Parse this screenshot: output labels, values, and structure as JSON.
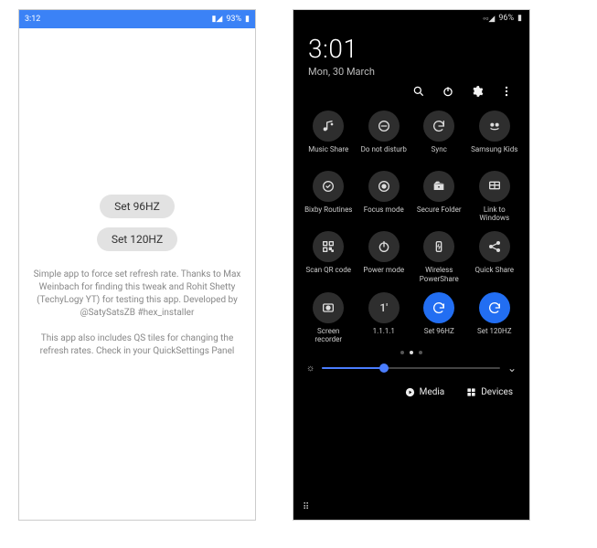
{
  "left": {
    "statusbar": {
      "time": "3:12",
      "battery": "93%"
    },
    "buttons": {
      "set96": "Set 96HZ",
      "set120": "Set 120HZ"
    },
    "desc1": "Simple app to force set refresh rate. Thanks to Max Weinbach for finding this tweak and Rohit Shetty (TechyLogy YT) for testing this app. Developed by @SatySatsZB #hex_installer",
    "desc2": "This app also includes QS tiles for changing the refresh rates. Check in your QuickSettings Panel"
  },
  "right": {
    "statusbar": {
      "battery": "96%"
    },
    "clock": {
      "time": "3:01",
      "date": "Mon, 30 March"
    },
    "actions": {
      "search": "Search",
      "power": "Power",
      "settings": "Settings",
      "more": "More"
    },
    "tiles": [
      {
        "icon": "music-share",
        "label": "Music Share",
        "active": false
      },
      {
        "icon": "dnd",
        "label": "Do not disturb",
        "active": false
      },
      {
        "icon": "sync",
        "label": "Sync",
        "active": false
      },
      {
        "icon": "samsung-kids",
        "label": "Samsung Kids",
        "active": false
      },
      {
        "icon": "bixby",
        "label": "Bixby Routines",
        "active": false
      },
      {
        "icon": "focus",
        "label": "Focus mode",
        "active": false
      },
      {
        "icon": "secure-folder",
        "label": "Secure Folder",
        "active": false
      },
      {
        "icon": "link-windows",
        "label": "Link to Windows",
        "active": false
      },
      {
        "icon": "qr",
        "label": "Scan QR code",
        "active": false
      },
      {
        "icon": "power-mode",
        "label": "Power mode",
        "active": false
      },
      {
        "icon": "powershare",
        "label": "Wireless PowerShare",
        "active": false
      },
      {
        "icon": "quick-share",
        "label": "Quick Share",
        "active": false
      },
      {
        "icon": "screen-rec",
        "label": "Screen recorder",
        "active": false
      },
      {
        "icon": "1111",
        "label": "1.1.1.1",
        "active": false
      },
      {
        "icon": "refresh",
        "label": "Set 96HZ",
        "active": true
      },
      {
        "icon": "refresh",
        "label": "Set 120HZ",
        "active": true
      }
    ],
    "brightness": {
      "percent": 35
    },
    "bottom": {
      "media": "Media",
      "devices": "Devices"
    }
  }
}
